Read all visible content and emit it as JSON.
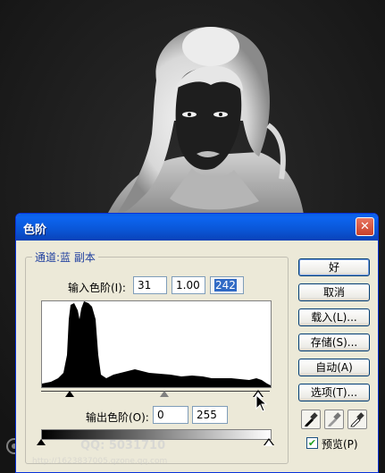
{
  "dialog": {
    "title": "色阶",
    "close_glyph": "✕",
    "channel_label": "通道:蓝 副本",
    "input_levels_label": "输入色阶(I):",
    "input_black": "31",
    "input_gamma": "1.00",
    "input_white": "242",
    "output_levels_label": "输出色阶(O):",
    "output_black": "0",
    "output_white": "255",
    "buttons": {
      "ok": "好",
      "cancel": "取消",
      "load": "载入(L)...",
      "save": "存储(S)...",
      "auto": "自动(A)",
      "options": "选项(T)..."
    },
    "preview_label": "预览(P)",
    "preview_checked": true
  },
  "watermark": {
    "line1": "QQ: 5031710",
    "line2": "http://1623837005.qzone.qq.com"
  },
  "colors": {
    "title_bar": "#0A56D6",
    "dialog_bg": "#ECE9D8",
    "selection": "#316AC5",
    "close": "#C8412B"
  },
  "icons": [
    "close-icon",
    "black-eyedropper-icon",
    "gray-eyedropper-icon",
    "white-eyedropper-icon",
    "checkmark-icon",
    "mouse-cursor-icon"
  ]
}
